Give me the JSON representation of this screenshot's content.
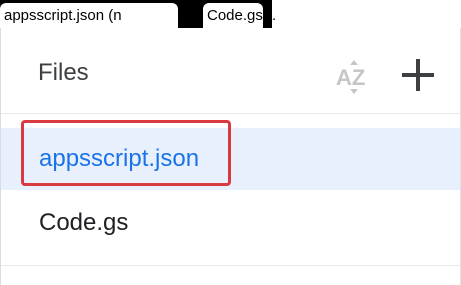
{
  "caption": {
    "part1": "appsscript.json  (n",
    "part2": "Code.gs ).",
    "highlight_color": "#d93a3f"
  },
  "files_panel": {
    "title": "Files",
    "sort_icon": "sort-az-icon",
    "sort_icon_text": "AZ",
    "add_icon": "plus-icon",
    "files": [
      {
        "name": "appsscript.json",
        "selected": true
      },
      {
        "name": "Code.gs",
        "selected": false
      }
    ]
  },
  "colors": {
    "selected_bg": "#e8f0fe",
    "selected_text": "#1a73e8",
    "text": "#202124"
  }
}
